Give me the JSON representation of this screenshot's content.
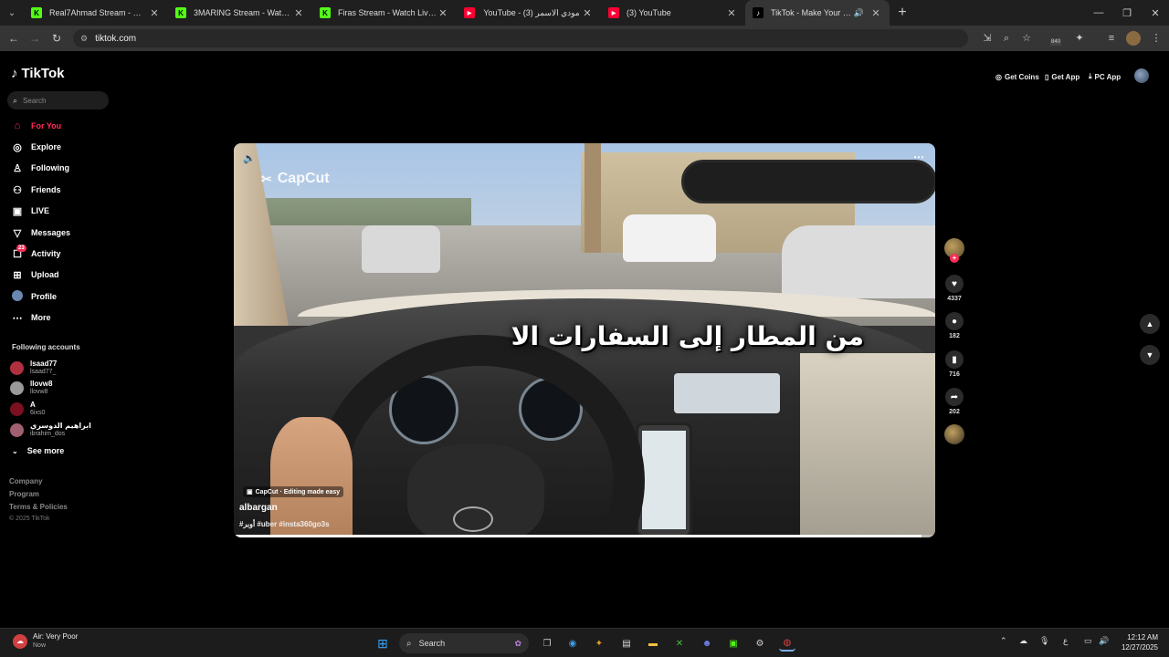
{
  "browser": {
    "tabs": [
      {
        "title": "Real7Ahmad Stream - Watch Li",
        "fav_color": "#53fc18",
        "fav_glyph": "K"
      },
      {
        "title": "3MARING Stream - Watch Live",
        "fav_color": "#53fc18",
        "fav_glyph": "K"
      },
      {
        "title": "Firas Stream - Watch Live on Ki",
        "fav_color": "#53fc18",
        "fav_glyph": "K"
      },
      {
        "title": "YouTube - (3) مودي الاسمر",
        "fav_color": "#ff0033",
        "fav_glyph": "▶"
      },
      {
        "title": "(3) YouTube",
        "fav_color": "#ff0033",
        "fav_glyph": "▶"
      },
      {
        "title": "TikTok - Make Your Day",
        "fav_color": "#000000",
        "fav_glyph": "♪"
      }
    ],
    "url": "tiktok.com",
    "extension_badge": "840"
  },
  "tiktok": {
    "logo": "TikTok",
    "search_placeholder": "Search",
    "nav": [
      {
        "label": "For You",
        "icon": "home-icon"
      },
      {
        "label": "Explore",
        "icon": "compass-icon"
      },
      {
        "label": "Following",
        "icon": "following-icon"
      },
      {
        "label": "Friends",
        "icon": "friends-icon"
      },
      {
        "label": "LIVE",
        "icon": "live-icon"
      },
      {
        "label": "Messages",
        "icon": "messages-icon"
      },
      {
        "label": "Activity",
        "icon": "activity-icon",
        "badge": "23"
      },
      {
        "label": "Upload",
        "icon": "upload-icon"
      },
      {
        "label": "Profile",
        "icon": "profile-icon"
      },
      {
        "label": "More",
        "icon": "more-icon"
      }
    ],
    "following_title": "Following accounts",
    "accounts": [
      {
        "name": "lsaad77",
        "user": "lsaad77_",
        "color": "#b03040"
      },
      {
        "name": "llovw8",
        "user": "llovw8",
        "color": "#9a9a9a"
      },
      {
        "name": "A",
        "user": "6ixs0",
        "color": "#7a1020"
      },
      {
        "name": "ابراهيم الدوسري",
        "user": "ibrahim_dos",
        "color": "#a06070"
      }
    ],
    "see_more": "See more",
    "footer": {
      "company": "Company",
      "program": "Program",
      "terms": "Terms & Policies",
      "copyright": "© 2025 TikTok"
    },
    "top_right": {
      "get_coins": "Get Coins",
      "get_app": "Get App",
      "pc_app": "PC App"
    },
    "video": {
      "watermark": "CapCut",
      "caption_overlay": "من المطار إلى السفارات الا",
      "capcut_tag": "CapCut · Editing made easy",
      "author": "albargan",
      "tags": "#أوبر #uber #insta360go3s",
      "progress_fraction": 0.98
    },
    "actions": {
      "likes": "4337",
      "comments": "182",
      "saves": "716",
      "shares": "202"
    }
  },
  "taskbar": {
    "weather_title": "Air: Very Poor",
    "weather_sub": "Now",
    "search_label": "Search",
    "lang": "ع",
    "time": "12:12 AM",
    "date": "12/27/2025"
  }
}
